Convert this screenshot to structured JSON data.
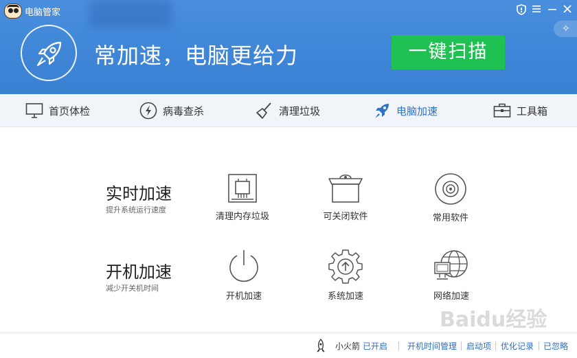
{
  "app": {
    "title": "电脑管家"
  },
  "header": {
    "headline": "常加速，电脑更给力",
    "scan_button": "一键扫描"
  },
  "tabs": [
    {
      "label": "首页体检",
      "icon": "monitor-icon"
    },
    {
      "label": "病毒查杀",
      "icon": "lightning-icon"
    },
    {
      "label": "清理垃圾",
      "icon": "broom-icon"
    },
    {
      "label": "电脑加速",
      "icon": "rocket-icon",
      "active": true
    },
    {
      "label": "工具箱",
      "icon": "toolbox-icon"
    }
  ],
  "groups": [
    {
      "title": "实时加速",
      "subtitle": "提升系统运行速度",
      "tools": [
        {
          "label": "清理内存垃圾",
          "icon": "memory-chip-icon"
        },
        {
          "label": "可关闭软件",
          "icon": "software-box-icon"
        },
        {
          "label": "常用软件",
          "icon": "disc-icon"
        }
      ]
    },
    {
      "title": "开机加速",
      "subtitle": "减少开关机时间",
      "tools": [
        {
          "label": "开机加速",
          "icon": "power-icon"
        },
        {
          "label": "系统加速",
          "icon": "gear-arrow-icon"
        },
        {
          "label": "网络加速",
          "icon": "network-globe-icon"
        }
      ]
    }
  ],
  "footer": {
    "rocket_label": "小火箭",
    "rocket_status": "已开启",
    "links": [
      "开机时间管理",
      "启动项",
      "优化记录",
      "已忽略"
    ]
  },
  "watermark": "Baidu经验",
  "colors": {
    "header_blue": "#3f86d8",
    "scan_green": "#1fc152",
    "active_tab": "#2d73cc",
    "link_blue": "#2d6fc6"
  }
}
